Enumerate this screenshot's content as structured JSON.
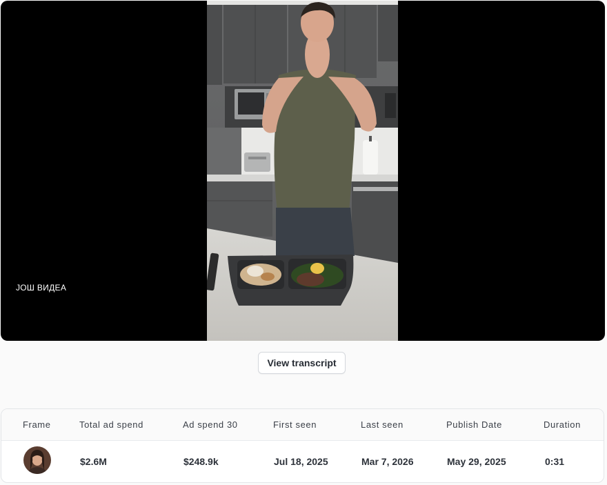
{
  "player": {
    "more_videos_label": "ЈОШ ВИДЕА"
  },
  "transcript_button": {
    "label": "View transcript"
  },
  "table": {
    "headers": [
      "Frame",
      "Total ad spend",
      "Ad spend 30",
      "First seen",
      "Last seen",
      "Publish Date",
      "Duration"
    ],
    "rows": [
      {
        "frame_icon": "creator-thumbnail",
        "total_ad_spend": "$2.6M",
        "ad_spend_30": "$248.9k",
        "first_seen": "Jul 18, 2025",
        "last_seen": "Mar 7, 2026",
        "publish_date": "May 29, 2025",
        "duration": "0:31"
      }
    ]
  }
}
